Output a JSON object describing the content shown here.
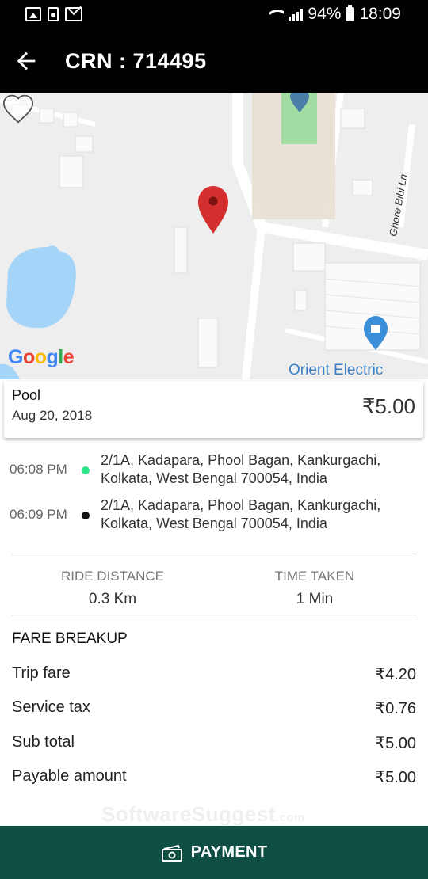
{
  "status_bar": {
    "battery": "94%",
    "time": "18:09",
    "icons": [
      "photo-icon",
      "camera-notification-icon",
      "mail-icon",
      "wifi-icon",
      "signal-icon",
      "battery-icon"
    ]
  },
  "app_bar": {
    "title": "CRN : 714495",
    "back_icon": "back-arrow-icon"
  },
  "map": {
    "provider": "Google",
    "poi_label": "Orient Electric",
    "road_label": "Ghore Bibi Ln",
    "icons": [
      "map-pin-icon",
      "favorite-heart-icon",
      "shop-marker-icon",
      "park-marker-icon"
    ]
  },
  "ride": {
    "type": "Pool",
    "date": "Aug 20, 2018",
    "amount": "₹5.00"
  },
  "stops": [
    {
      "time": "06:08 PM",
      "address": "2/1A, Kadapara, Phool Bagan, Kankurgachi, Kolkata, West Bengal 700054, India",
      "dot_color": "#2ee58a"
    },
    {
      "time": "06:09 PM",
      "address": "2/1A, Kadapara, Phool Bagan, Kankurgachi, Kolkata, West Bengal 700054, India",
      "dot_color": "#111111"
    }
  ],
  "stats": {
    "distance_label": "RIDE DISTANCE",
    "distance_value": "0.3 Km",
    "time_label": "TIME TAKEN",
    "time_value": "1 Min"
  },
  "fare": {
    "heading": "FARE BREAKUP",
    "rows": [
      {
        "label": "Trip fare",
        "value": "₹4.20"
      },
      {
        "label": "Service tax",
        "value": "₹0.76"
      },
      {
        "label": "Sub total",
        "value": "₹5.00"
      },
      {
        "label": "Payable amount",
        "value": "₹5.00"
      }
    ]
  },
  "watermark": {
    "brand": "SoftwareSuggest",
    "suffix": ".com"
  },
  "payment": {
    "label": "PAYMENT",
    "icon": "cash-icon"
  },
  "colors": {
    "primary": "#0e4e43",
    "pin": "#d32f2f",
    "water": "#a4d4f8",
    "park": "#a3dca2",
    "poi": "#3b7fc4"
  }
}
